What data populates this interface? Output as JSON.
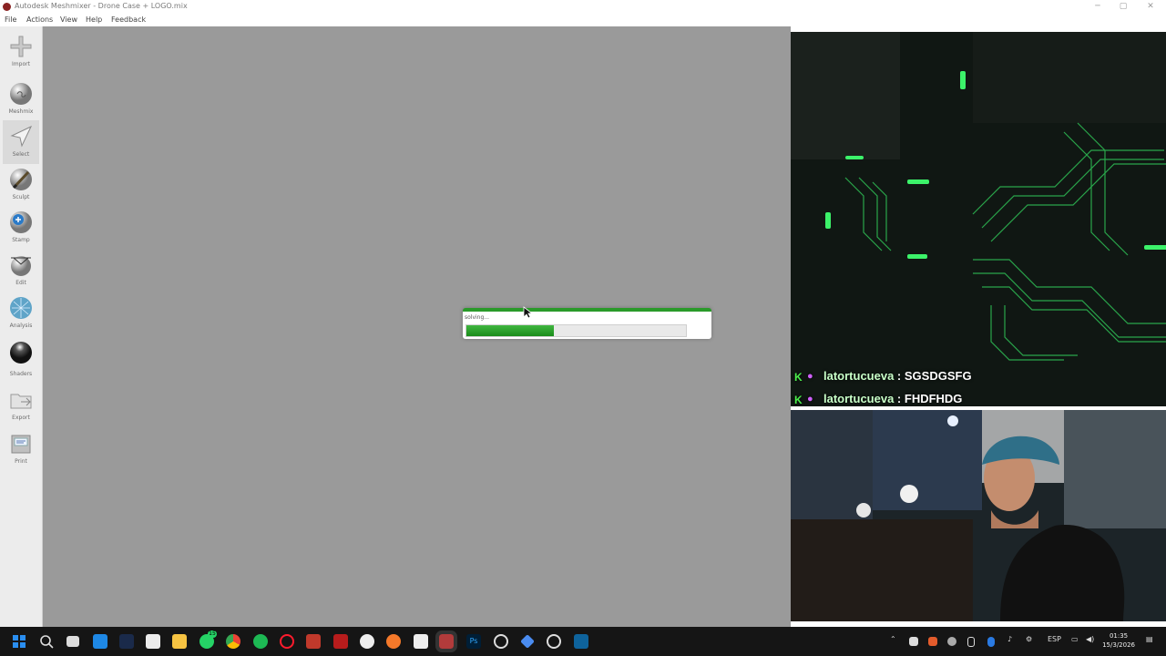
{
  "window": {
    "title": "Autodesk Meshmixer - Drone Case + LOGO.mix",
    "minimize": "─",
    "maximize": "▢",
    "close": "✕"
  },
  "menu": [
    "File",
    "Actions",
    "View",
    "Help",
    "Feedback"
  ],
  "tools": [
    {
      "label": "Import",
      "icon": "plus-icon"
    },
    {
      "label": "Meshmix",
      "icon": "meshmix-sphere-icon"
    },
    {
      "label": "Select",
      "icon": "select-arrow-icon"
    },
    {
      "label": "Sculpt",
      "icon": "brush-icon"
    },
    {
      "label": "Stamp",
      "icon": "stamp-sphere-icon"
    },
    {
      "label": "Edit",
      "icon": "edit-sphere-icon"
    },
    {
      "label": "Analysis",
      "icon": "analysis-sphere-icon"
    },
    {
      "label": "Shaders",
      "icon": "shader-sphere-icon"
    },
    {
      "label": "Export",
      "icon": "export-folder-icon"
    },
    {
      "label": "Print",
      "icon": "printer-icon"
    }
  ],
  "dialog": {
    "text": "solving...",
    "progress": 0.4
  },
  "chat": [
    {
      "user": "latortucueva",
      "message": "SGSDGSFG"
    },
    {
      "user": "latortucueva",
      "message": "FHDFHDG"
    }
  ],
  "taskbar": {
    "icons": [
      "start-icon",
      "search-icon",
      "task-view-icon",
      "store-icon",
      "terminal-icon",
      "app-icon",
      "file-explorer-icon",
      "whatsapp-icon",
      "chrome-icon",
      "spotify-icon",
      "opera-icon",
      "game-icon",
      "app-red-icon",
      "app-s-icon",
      "blender-icon",
      "inkscape-icon",
      "meshmixer-icon",
      "photoshop-icon",
      "chatgpt-icon",
      "gemini-icon",
      "app-icon",
      "visual-studio-icon"
    ],
    "lang": "ESP",
    "time": "01:35",
    "date": "15/3/2026",
    "badge": "15"
  },
  "colors": {
    "accent_green": "#2a9a2a",
    "viewport": "#9a9a9a"
  }
}
